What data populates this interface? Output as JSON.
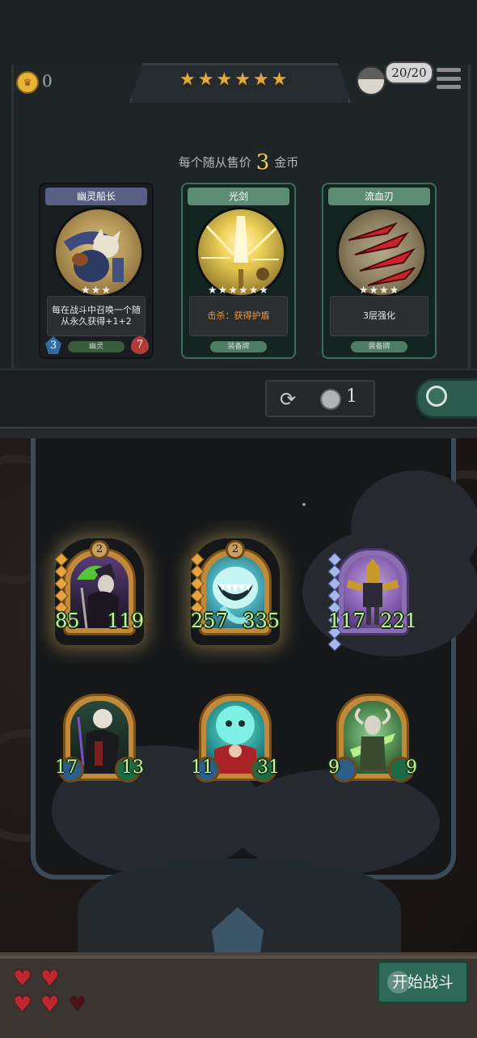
{
  "header": {
    "gold": "0",
    "star_rating": 6,
    "hp_current": "20",
    "hp_max": "20"
  },
  "shop": {
    "price_prefix": "每个随从售价",
    "price_value": "3",
    "price_suffix": "金币",
    "cards": [
      {
        "name": "幽灵船长",
        "stars": "★★★",
        "description": "每在战斗中召唤一个随从永久获得+1+2",
        "tag": "幽灵",
        "attack": "3",
        "health": "7"
      },
      {
        "name": "光剑",
        "stars": "★★★★★★",
        "description": "击杀：获得护盾",
        "tag": "装备牌"
      },
      {
        "name": "流血刃",
        "stars": "★★★★",
        "description": "3层强化",
        "tag": "装备牌"
      }
    ],
    "refresh_cost": "1"
  },
  "board": {
    "minions": [
      {
        "level": "2",
        "attack": "85",
        "health": "119",
        "pips": 5
      },
      {
        "level": "2",
        "attack": "257",
        "health": "335",
        "pips": 5
      },
      {
        "attack": "117",
        "health": "221",
        "pips": 8
      },
      {
        "attack": "17",
        "health": "13",
        "pips": 0
      },
      {
        "attack": "11",
        "health": "31",
        "pips": 0
      },
      {
        "attack": "9",
        "health": "9",
        "pips": 0
      }
    ]
  },
  "footer": {
    "lives_full": 4,
    "lives_total": 5,
    "start_battle_label": "开始战斗"
  },
  "colors": {
    "gold": "#e7b437",
    "stat_green": "#c6f0a3",
    "start_button": "#2f6a58",
    "heart": "#c0262e"
  },
  "icons": {
    "coin": "coin-icon",
    "menu": "hamburger-menu-icon",
    "refresh": "refresh-icon",
    "search": "magnifier-icon",
    "heart": "heart-icon"
  }
}
